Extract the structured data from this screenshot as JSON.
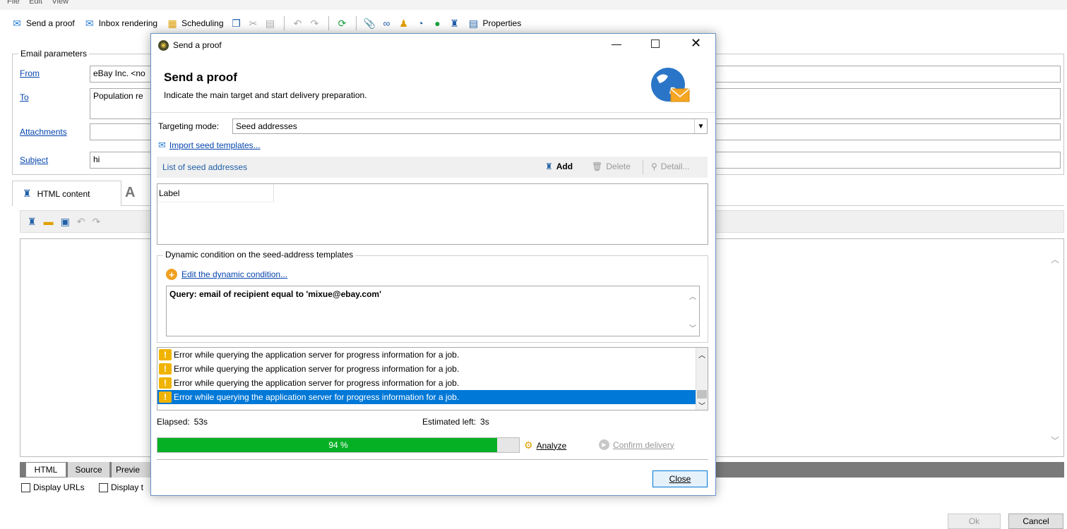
{
  "menu": [
    "File",
    "Edit",
    "View"
  ],
  "toolbar": {
    "send_proof": "Send a proof",
    "inbox_rendering": "Inbox rendering",
    "scheduling": "Scheduling",
    "properties": "Properties"
  },
  "params": {
    "legend": "Email parameters",
    "from_label": "From",
    "from_value": "eBay Inc. <no",
    "to_label": "To",
    "to_value": "Population re",
    "attachments_label": "Attachments",
    "subject_label": "Subject",
    "subject_value": "hi"
  },
  "content_tabs": {
    "html_content": "HTML content",
    "bottom_html": "HTML",
    "bottom_source": "Source",
    "bottom_preview": "Previe"
  },
  "checkboxes": {
    "display_urls": "Display URLs",
    "display_t": "Display t"
  },
  "footer_buttons": {
    "ok": "Ok",
    "cancel": "Cancel"
  },
  "dialog": {
    "title": "Send a proof",
    "heading": "Send a proof",
    "subheading": "Indicate the main target and start delivery preparation.",
    "targeting_label": "Targeting mode:",
    "targeting_value": "Seed addresses",
    "import_link": "Import seed templates...",
    "list_title": "List of seed addresses",
    "add": "Add",
    "delete": "Delete",
    "detail": "Detail...",
    "col_label": "Label",
    "dyn_legend": "Dynamic condition on the seed-address templates",
    "dyn_link": "Edit the dynamic condition...",
    "query": "Query: email of recipient equal to 'mixue@ebay.com'",
    "errors": [
      "Error while querying the application server for progress information for a job.",
      "Error while querying the application server for progress information for a job.",
      "Error while querying the application server for progress information for a job.",
      "Error while querying the application server for progress information for a job."
    ],
    "elapsed_label": "Elapsed:",
    "elapsed_value": "53s",
    "estimated_label": "Estimated left:",
    "estimated_value": "3s",
    "progress_percent": 94,
    "progress_text": "94 %",
    "analyze": "Analyze",
    "confirm": "Confirm delivery",
    "close": "Close"
  },
  "colors": {
    "progress": "#06b025",
    "selected": "#0078d7",
    "link": "#0645ad",
    "warning": "#f0b400"
  }
}
